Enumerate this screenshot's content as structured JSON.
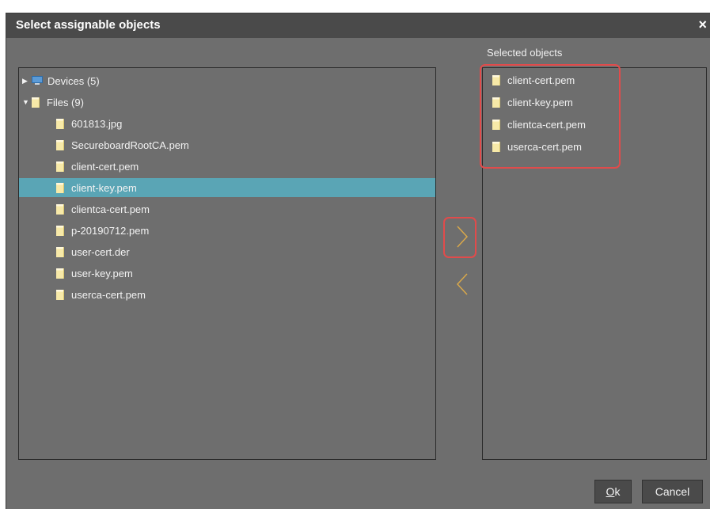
{
  "dialog": {
    "title": "Select assignable objects",
    "close_glyph": "×"
  },
  "left_tree": {
    "nodes": [
      {
        "label": "Devices (5)",
        "expanded": false,
        "icon": "monitor-icon"
      },
      {
        "label": "Files (9)",
        "expanded": true,
        "icon": "file-icon"
      }
    ],
    "files": [
      {
        "label": "601813.jpg",
        "selected": false
      },
      {
        "label": "SecureboardRootCA.pem",
        "selected": false
      },
      {
        "label": "client-cert.pem",
        "selected": false
      },
      {
        "label": "client-key.pem",
        "selected": true
      },
      {
        "label": "clientca-cert.pem",
        "selected": false
      },
      {
        "label": "p-20190712.pem",
        "selected": false
      },
      {
        "label": "user-cert.der",
        "selected": false
      },
      {
        "label": "user-key.pem",
        "selected": false
      },
      {
        "label": "userca-cert.pem",
        "selected": false
      }
    ]
  },
  "right_list": {
    "label": "Selected objects",
    "items": [
      "client-cert.pem",
      "client-key.pem",
      "clientca-cert.pem",
      "userca-cert.pem"
    ]
  },
  "buttons": {
    "ok_mnemonic": "O",
    "ok_rest": "k",
    "cancel": "Cancel"
  },
  "colors": {
    "dialog_bg": "#6e6e6e",
    "titlebar_bg": "#4a4a4a",
    "selection": "#5aa5b5",
    "arrow": "#d9a84a",
    "highlight": "#e14b4b"
  }
}
